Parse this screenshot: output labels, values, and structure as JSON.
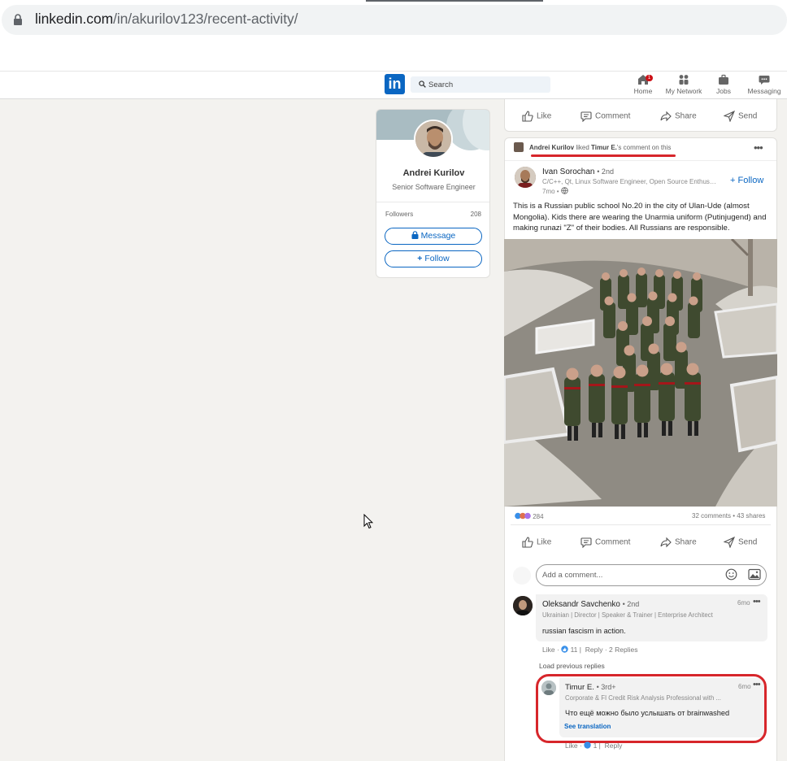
{
  "browser": {
    "url_host": "linkedin.com",
    "url_path": "/in/akurilov123/recent-activity/"
  },
  "nav": {
    "logo": "in",
    "search_placeholder": "Search",
    "items": [
      {
        "label": "Home",
        "icon": "home-icon"
      },
      {
        "label": "My Network",
        "icon": "network-icon"
      },
      {
        "label": "Jobs",
        "icon": "briefcase-icon"
      },
      {
        "label": "Messaging",
        "icon": "messaging-icon"
      }
    ],
    "notification_count": "1"
  },
  "profile_card": {
    "name": "Andrei Kurilov",
    "title": "Senior Software Engineer",
    "followers_label": "Followers",
    "followers_count": "208",
    "message_button": "Message",
    "follow_button": "Follow"
  },
  "actions": {
    "like": "Like",
    "comment": "Comment",
    "share": "Share",
    "send": "Send"
  },
  "post": {
    "liked_actor": "Andrei Kurilov",
    "liked_verb": "liked",
    "liked_target": "Timur E.",
    "liked_suffix": "'s comment on this",
    "author_name": "Ivan Sorochan",
    "author_degree": "• 2nd",
    "author_headline": "C/C++, Qt, Linux Software Engineer, Open Source Enthusiast",
    "time": "7mo •",
    "follow_label": "+ Follow",
    "text": "This is a Russian public school No.20 in the city of Ulan-Ude (almost Mongolia). Kids there are wearing the Unarmia uniform (Putinjugend) and making runazi \"Z\" of their bodies. All Russians are responsible.",
    "reactions_count": "284",
    "comments_shares": "32 comments • 43 shares"
  },
  "comment_box": {
    "placeholder": "Add a comment..."
  },
  "comments": [
    {
      "name": "Oleksandr Savchenko",
      "degree": "• 2nd",
      "headline": "Ukrainian | Director | Speaker & Trainer | Enterprise Architect",
      "time": "6mo",
      "text": "russian fascism in action.",
      "like": "Like",
      "like_count": "11",
      "reply": "Reply",
      "replies": "2 Replies"
    }
  ],
  "load_previous": "Load previous replies",
  "reply": {
    "name": "Timur E.",
    "degree": "• 3rd+",
    "headline": "Corporate & FI Credit Risk Analysis Professional with ...",
    "time": "6mo",
    "text": "Что ещё можно было услышать от brainwashed",
    "see_translation": "See translation",
    "like": "Like",
    "like_count": "1",
    "reply": "Reply"
  },
  "colors": {
    "linkedin_blue": "#0a66c2",
    "highlight_red": "#d7262b",
    "page_bg": "#f3f2ef"
  }
}
